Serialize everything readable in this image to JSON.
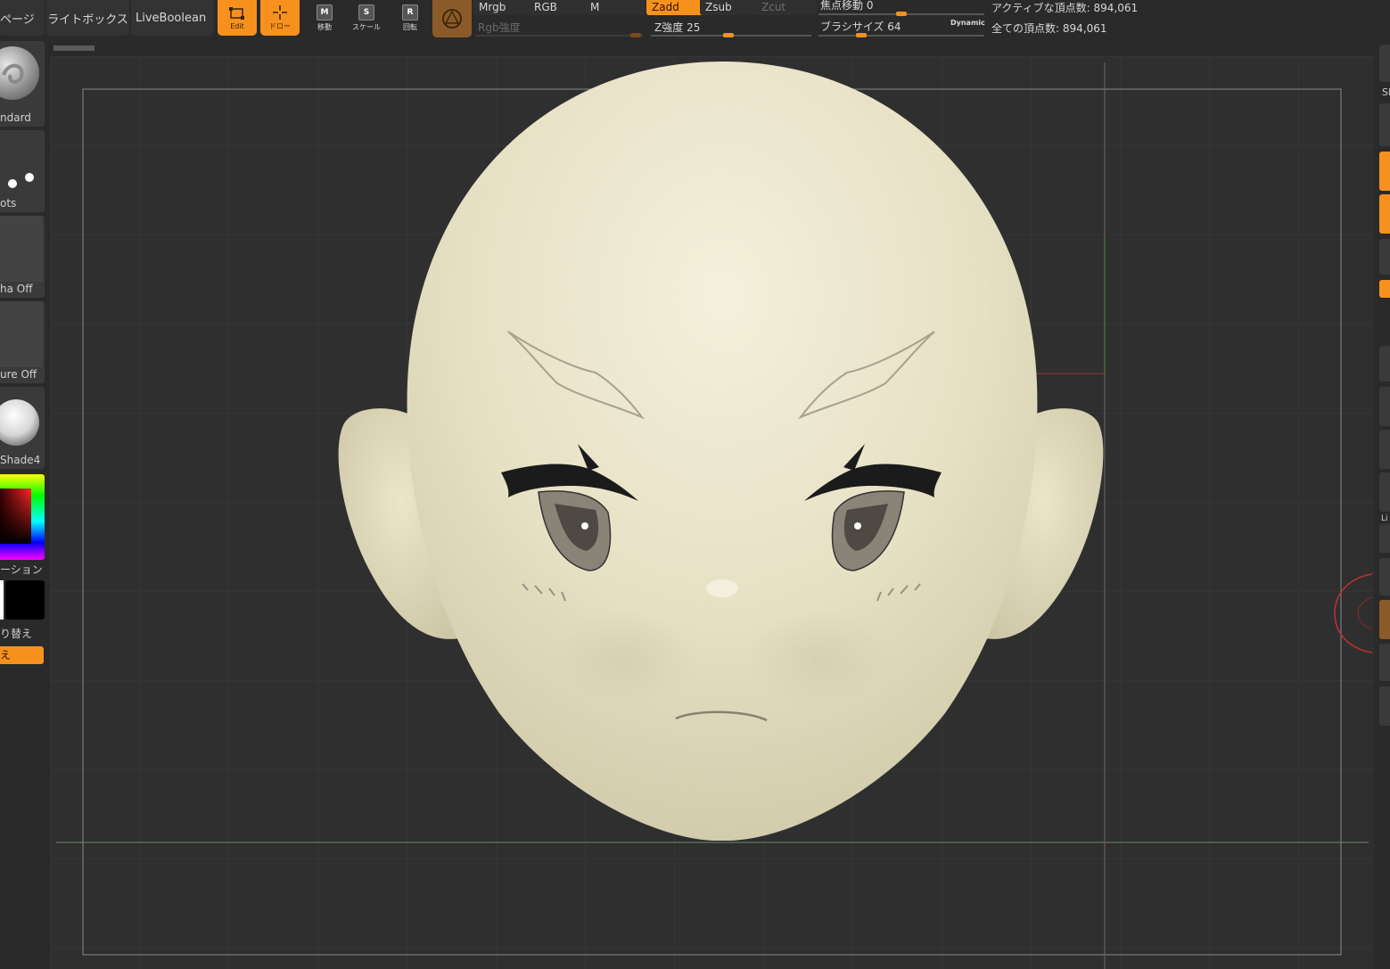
{
  "toolbar": {
    "page_tab": "ページ",
    "lightbox": "ライトボックス",
    "liveboolean": "LiveBoolean",
    "edit_label": "Edit",
    "draw_label": "ドロー",
    "move_key": "M",
    "move_label": "移動",
    "scale_key": "S",
    "scale_label": "スケール",
    "rotate_key": "R",
    "rotate_label": "回転",
    "mrgb": "Mrgb",
    "rgb": "RGB",
    "m": "M",
    "rgb_intensity": "Rgb強度",
    "zadd": "Zadd",
    "zsub": "Zsub",
    "zcut": "Zcut",
    "z_intensity_label": "Z強度",
    "z_intensity_value": "25",
    "z_intensity_fraction": 0.25,
    "focal_shift_label": "焦点移動",
    "focal_shift_value": "0",
    "brush_size_label": "ブラシサイズ",
    "brush_size_value": "64",
    "dynamic_label": "Dynamic",
    "active_points": "アクティブな頂点数: 894,061",
    "total_points": "全ての頂点数: 894,061"
  },
  "left_shelf": {
    "brush_label": "ndard",
    "stroke_label": "ots",
    "alpha_label": "ha Off",
    "texture_label": "ure Off",
    "material_label": "Shade4",
    "gradient_label": "ーション",
    "swap_label": "り替え",
    "orange_label": "え"
  },
  "right_shelf": {
    "label_sp": "SI",
    "label_li": "Li"
  },
  "colors": {
    "accent": "#f7911e",
    "model": "#e9e4c9"
  }
}
